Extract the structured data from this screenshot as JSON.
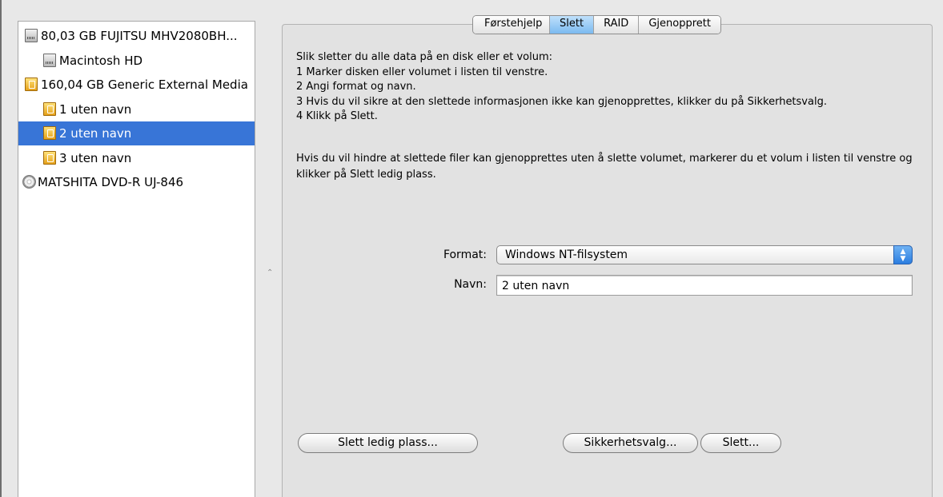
{
  "sidebar": {
    "items": [
      {
        "label": "80,03 GB FUJITSU MHV2080BH...",
        "icon": "hard-drive-icon"
      },
      {
        "label": "Macintosh HD",
        "icon": "hard-drive-icon"
      },
      {
        "label": "160,04 GB Generic External Media",
        "icon": "external-drive-icon"
      },
      {
        "label": "1 uten navn",
        "icon": "external-drive-icon"
      },
      {
        "label": "2 uten navn",
        "icon": "external-drive-icon",
        "selected": true
      },
      {
        "label": "3 uten navn",
        "icon": "external-drive-icon"
      },
      {
        "label": "MATSHITA DVD-R UJ-846",
        "icon": "dvd-drive-icon"
      }
    ]
  },
  "tabs": [
    {
      "label": "Førstehjelp"
    },
    {
      "label": "Slett",
      "active": true
    },
    {
      "label": "RAID"
    },
    {
      "label": "Gjenopprett"
    }
  ],
  "instructions": [
    "Slik sletter du alle data på en disk eller et volum:",
    "1 Marker disken eller volumet i listen til venstre.",
    "2 Angi format og navn.",
    "3 Hvis du vil sikre at den slettede informasjonen ikke kan gjenopprettes, klikker du på Sikkerhetsvalg.",
    "4 Klikk på Slett."
  ],
  "paragraph": "Hvis du vil hindre at slettede filer kan gjenopprettes uten å slette volumet, markerer du et volum i listen til venstre og klikker på Slett ledig plass.",
  "form": {
    "format_label": "Format:",
    "format_value": "Windows NT-filsystem",
    "name_label": "Navn:",
    "name_value": "2 uten navn"
  },
  "buttons": {
    "erase_free_space": "Slett ledig plass...",
    "security_options": "Sikkerhetsvalg...",
    "erase": "Slett..."
  },
  "colors": {
    "selection": "#3875d7",
    "active_tab": "#7bbaf0"
  }
}
